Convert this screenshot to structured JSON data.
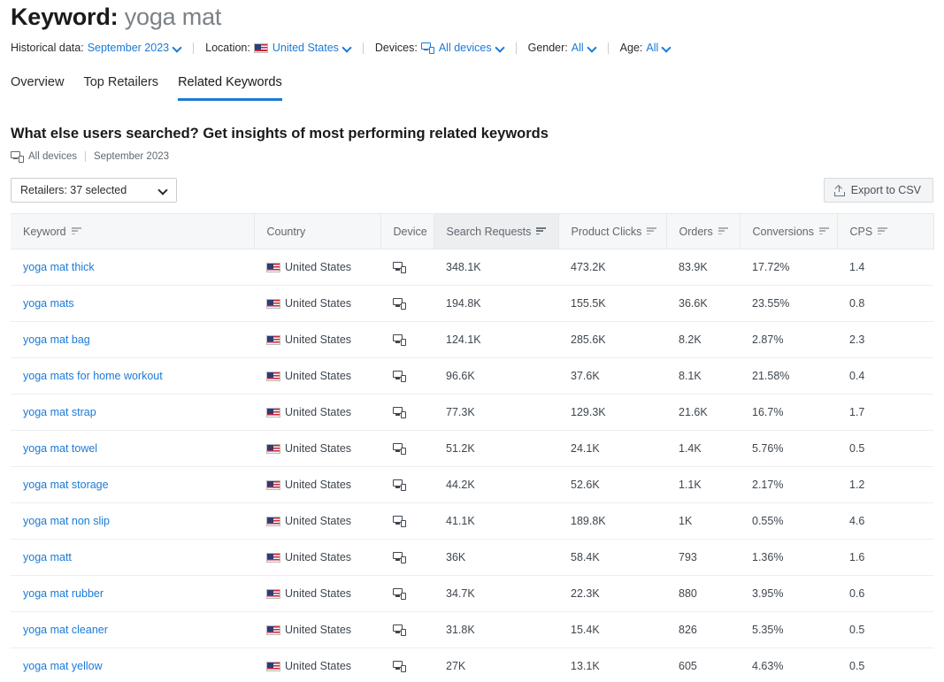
{
  "header": {
    "title_label": "Keyword:",
    "title_value": "yoga mat"
  },
  "filters": {
    "historical_label": "Historical data:",
    "historical_value": "September 2023",
    "location_label": "Location:",
    "location_value": "United States",
    "devices_label": "Devices:",
    "devices_value": "All devices",
    "gender_label": "Gender:",
    "gender_value": "All",
    "age_label": "Age:",
    "age_value": "All"
  },
  "tabs": [
    {
      "label": "Overview",
      "active": false
    },
    {
      "label": "Top Retailers",
      "active": false
    },
    {
      "label": "Related Keywords",
      "active": true
    }
  ],
  "section": {
    "title": "What else users searched? Get insights of most performing related keywords",
    "meta_devices": "All devices",
    "meta_period": "September 2023"
  },
  "controls": {
    "retailers_select": "Retailers: 37 selected",
    "export_label": "Export to CSV"
  },
  "table": {
    "columns": [
      {
        "label": "Keyword",
        "sortable": true,
        "sorted": false
      },
      {
        "label": "Country",
        "sortable": false,
        "sorted": false
      },
      {
        "label": "Device",
        "sortable": false,
        "sorted": false
      },
      {
        "label": "Search Requests",
        "sortable": true,
        "sorted": true
      },
      {
        "label": "Product Clicks",
        "sortable": true,
        "sorted": false
      },
      {
        "label": "Orders",
        "sortable": true,
        "sorted": false
      },
      {
        "label": "Conversions",
        "sortable": true,
        "sorted": false
      },
      {
        "label": "CPS",
        "sortable": true,
        "sorted": false
      }
    ],
    "rows": [
      {
        "keyword": "yoga mat thick",
        "country": "United States",
        "device": "all-devices",
        "search_requests": "348.1K",
        "product_clicks": "473.2K",
        "orders": "83.9K",
        "conversions": "17.72%",
        "cps": "1.4"
      },
      {
        "keyword": "yoga mats",
        "country": "United States",
        "device": "all-devices",
        "search_requests": "194.8K",
        "product_clicks": "155.5K",
        "orders": "36.6K",
        "conversions": "23.55%",
        "cps": "0.8"
      },
      {
        "keyword": "yoga mat bag",
        "country": "United States",
        "device": "all-devices",
        "search_requests": "124.1K",
        "product_clicks": "285.6K",
        "orders": "8.2K",
        "conversions": "2.87%",
        "cps": "2.3"
      },
      {
        "keyword": "yoga mats for home workout",
        "country": "United States",
        "device": "all-devices",
        "search_requests": "96.6K",
        "product_clicks": "37.6K",
        "orders": "8.1K",
        "conversions": "21.58%",
        "cps": "0.4"
      },
      {
        "keyword": "yoga mat strap",
        "country": "United States",
        "device": "all-devices",
        "search_requests": "77.3K",
        "product_clicks": "129.3K",
        "orders": "21.6K",
        "conversions": "16.7%",
        "cps": "1.7"
      },
      {
        "keyword": "yoga mat towel",
        "country": "United States",
        "device": "all-devices",
        "search_requests": "51.2K",
        "product_clicks": "24.1K",
        "orders": "1.4K",
        "conversions": "5.76%",
        "cps": "0.5"
      },
      {
        "keyword": "yoga mat storage",
        "country": "United States",
        "device": "all-devices",
        "search_requests": "44.2K",
        "product_clicks": "52.6K",
        "orders": "1.1K",
        "conversions": "2.17%",
        "cps": "1.2"
      },
      {
        "keyword": "yoga mat non slip",
        "country": "United States",
        "device": "all-devices",
        "search_requests": "41.1K",
        "product_clicks": "189.8K",
        "orders": "1K",
        "conversions": "0.55%",
        "cps": "4.6"
      },
      {
        "keyword": "yoga matt",
        "country": "United States",
        "device": "all-devices",
        "search_requests": "36K",
        "product_clicks": "58.4K",
        "orders": "793",
        "conversions": "1.36%",
        "cps": "1.6"
      },
      {
        "keyword": "yoga mat rubber",
        "country": "United States",
        "device": "all-devices",
        "search_requests": "34.7K",
        "product_clicks": "22.3K",
        "orders": "880",
        "conversions": "3.95%",
        "cps": "0.6"
      },
      {
        "keyword": "yoga mat cleaner",
        "country": "United States",
        "device": "all-devices",
        "search_requests": "31.8K",
        "product_clicks": "15.4K",
        "orders": "826",
        "conversions": "5.35%",
        "cps": "0.5"
      },
      {
        "keyword": "yoga mat yellow",
        "country": "United States",
        "device": "all-devices",
        "search_requests": "27K",
        "product_clicks": "13.1K",
        "orders": "605",
        "conversions": "4.63%",
        "cps": "0.5"
      }
    ]
  },
  "colors": {
    "link": "#1b7ad6",
    "accent": "#1b7ad6",
    "header_bg": "#f6f7f8",
    "sorted_header_bg": "#eceef0",
    "text": "#3e464e",
    "muted": "#60686f"
  }
}
